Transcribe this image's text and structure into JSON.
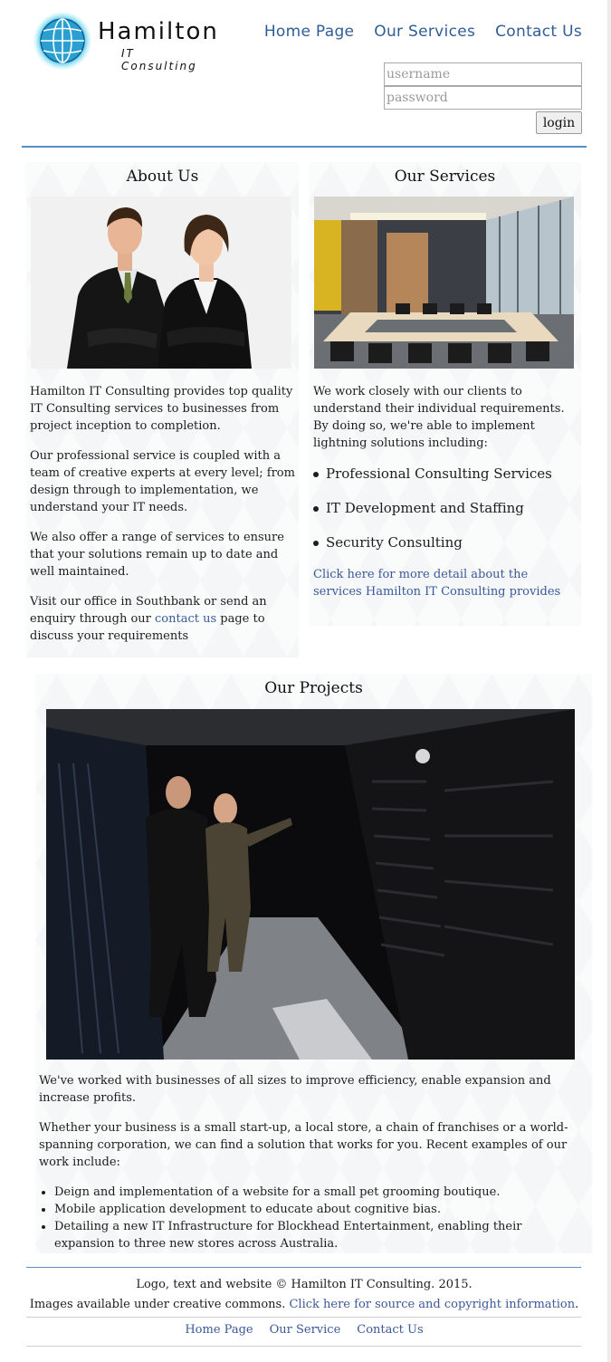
{
  "brand": {
    "name": "Hamilton",
    "subtitle": "IT Consulting"
  },
  "nav": {
    "home": "Home Page",
    "services": "Our Services",
    "contact": "Contact Us"
  },
  "login": {
    "username_placeholder": "username",
    "password_placeholder": "password",
    "button": "login"
  },
  "about": {
    "title": "About Us",
    "p1": "Hamilton IT Consulting provides top quality IT Consulting services to businesses from project inception to completion.",
    "p2": "Our professional service is coupled with a team of creative experts at every level; from design through to implementation, we understand your IT needs.",
    "p3": "We also offer a range of services to ensure that your solutions remain up to date and well maintained.",
    "p4_before": "Visit our office in Southbank or send an enquiry through our ",
    "p4_link": "contact us",
    "p4_after": " page to discuss your requirements"
  },
  "services": {
    "title": "Our Services",
    "intro": "We work closely with our clients to understand their individual requirements. By doing so, we're able to implement lightning solutions including:",
    "items": [
      "Professional Consulting Services",
      "IT Development and Staffing",
      "Security Consulting"
    ],
    "more_link": "Click here for more detail about the services Hamilton IT Consulting provides"
  },
  "projects": {
    "title": "Our Projects",
    "p1": "We've worked with businesses of all sizes to improve efficiency, enable expansion and increase profits.",
    "p2": "Whether your business is a small start-up, a local store, a chain of franchises or a world-spanning corporation, we can find a solution that works for you. Recent examples of our work include:",
    "items": [
      "Deign and implementation of a website for a small pet grooming boutique.",
      "Mobile application development to educate about cognitive bias.",
      "Detailing a new IT Infrastructure for Blockhead Entertainment, enabling their expansion to three new stores across Australia."
    ]
  },
  "footer": {
    "copyright": "Logo, text and website © Hamilton IT Consulting. 2015.",
    "images_before": "Images available under creative commons. ",
    "images_link": "Click here for source and copyright information",
    "images_after": ".",
    "nav_home": "Home Page",
    "nav_services": "Our Service",
    "nav_contact": "Contact Us"
  },
  "colors": {
    "nav_blue": "#2f5d96",
    "link_blue": "#3b5998",
    "rule_blue": "#5b8fc0",
    "panel_bg": "#f4f6f7"
  }
}
